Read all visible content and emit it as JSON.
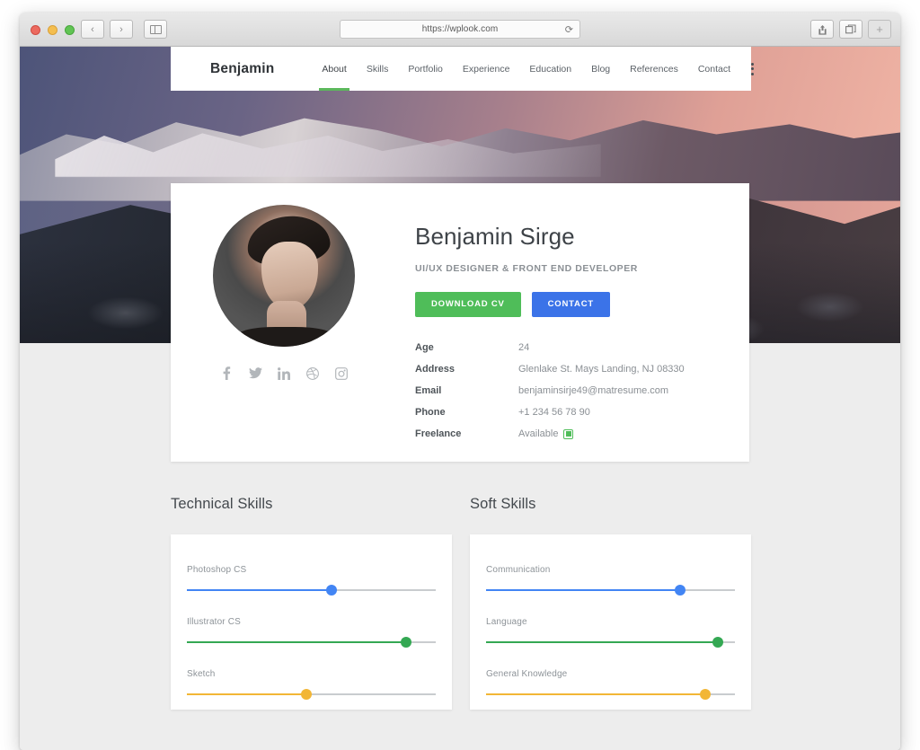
{
  "browser": {
    "url": "https://wplook.com",
    "reload_icon": "reload-icon",
    "back_icon": "chevron-left-icon",
    "forward_icon": "chevron-right-icon",
    "sidebar_icon": "sidebar-icon",
    "share_icon": "share-icon",
    "tabs_icon": "tabs-icon",
    "new_tab_label": "+"
  },
  "navbar": {
    "brand": "Benjamin",
    "menu_icon": "hamburger-icon",
    "more_icon": "kebab-menu-icon",
    "links": [
      {
        "label": "About",
        "active": true
      },
      {
        "label": "Skills",
        "active": false
      },
      {
        "label": "Portfolio",
        "active": false
      },
      {
        "label": "Experience",
        "active": false
      },
      {
        "label": "Education",
        "active": false
      },
      {
        "label": "Blog",
        "active": false
      },
      {
        "label": "References",
        "active": false
      },
      {
        "label": "Contact",
        "active": false
      }
    ]
  },
  "profile": {
    "name": "Benjamin Sirge",
    "role": "UI/UX DESIGNER & FRONT END DEVELOPER",
    "buttons": {
      "download_cv": "DOWNLOAD CV",
      "contact": "CONTACT"
    },
    "socials": [
      {
        "name": "facebook-icon"
      },
      {
        "name": "twitter-icon"
      },
      {
        "name": "linkedin-icon"
      },
      {
        "name": "dribbble-icon"
      },
      {
        "name": "instagram-icon"
      }
    ],
    "details": [
      {
        "label": "Age",
        "value": "24"
      },
      {
        "label": "Address",
        "value": "Glenlake St. Mays Landing, NJ 08330"
      },
      {
        "label": "Email",
        "value": "benjaminsirje49@matresume.com"
      },
      {
        "label": "Phone",
        "value": "+1 234 56 78 90"
      },
      {
        "label": "Freelance",
        "value": "Available"
      }
    ]
  },
  "skills": {
    "technical": {
      "title": "Technical Skills",
      "items": [
        {
          "name": "Photoshop CS",
          "value": 58,
          "color": "#4285f4"
        },
        {
          "name": "Illustrator CS",
          "value": 88,
          "color": "#34a853"
        },
        {
          "name": "Sketch",
          "value": 48,
          "color": "#f2b636"
        }
      ]
    },
    "soft": {
      "title": "Soft Skills",
      "items": [
        {
          "name": "Communication",
          "value": 78,
          "color": "#4285f4"
        },
        {
          "name": "Language",
          "value": 93,
          "color": "#34a853"
        },
        {
          "name": "General Knowledge",
          "value": 88,
          "color": "#f2b636"
        }
      ]
    }
  },
  "colors": {
    "accent_green": "#4fbd59",
    "accent_blue": "#3b73e8",
    "slider_blue": "#4285f4",
    "slider_green": "#34a853",
    "slider_yellow": "#f2b636",
    "page_bg": "#ededed"
  }
}
